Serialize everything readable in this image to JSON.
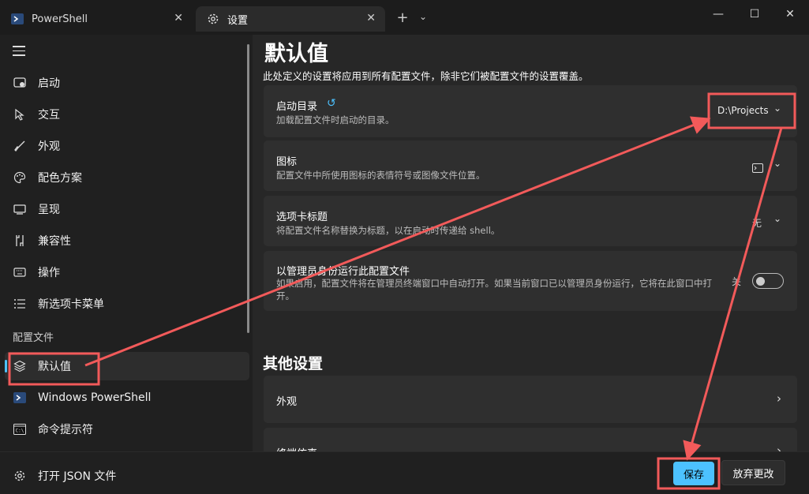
{
  "tabs": [
    {
      "label": "PowerShell",
      "icon": "powershell-icon"
    },
    {
      "label": "设置",
      "icon": "gear-icon"
    }
  ],
  "window_controls": {
    "minimize": "—",
    "maximize": "☐",
    "close": "✕"
  },
  "sidebar": {
    "items": [
      {
        "label": "启动",
        "icon": "startup-icon"
      },
      {
        "label": "交互",
        "icon": "cursor-icon"
      },
      {
        "label": "外观",
        "icon": "brush-icon"
      },
      {
        "label": "配色方案",
        "icon": "palette-icon"
      },
      {
        "label": "呈现",
        "icon": "monitor-icon"
      },
      {
        "label": "兼容性",
        "icon": "compat-icon"
      },
      {
        "label": "操作",
        "icon": "keyboard-icon"
      },
      {
        "label": "新选项卡菜单",
        "icon": "list-icon"
      }
    ],
    "section_label": "配置文件",
    "profiles": [
      {
        "label": "默认值",
        "icon": "layers-icon",
        "active": true
      },
      {
        "label": "Windows PowerShell",
        "icon": "powershell-icon"
      },
      {
        "label": "命令提示符",
        "icon": "cmd-icon"
      }
    ],
    "open_json": {
      "label": "打开 JSON 文件",
      "icon": "gear-icon"
    }
  },
  "main": {
    "title": "默认值",
    "description": "此处定义的设置将应用到所有配置文件，除非它们被配置文件的设置覆盖。",
    "cards": [
      {
        "title": "启动目录",
        "desc": "加载配置文件时启动的目录。",
        "value": "D:\\Projects"
      },
      {
        "title": "图标",
        "desc": "配置文件中所使用图标的表情符号或图像文件位置。"
      },
      {
        "title": "选项卡标题",
        "desc": "将配置文件名称替换为标题，以在启动时传递给 shell。",
        "value": "无"
      },
      {
        "title": "以管理员身份运行此配置文件",
        "desc": "如果启用，配置文件将在管理员终端窗口中自动打开。如果当前窗口已以管理员身份运行，它将在此窗口中打开。",
        "toggle_label": "关",
        "toggle_on": false
      }
    ],
    "other_title": "其他设置",
    "other_items": [
      {
        "label": "外观"
      },
      {
        "label": "终端仿真"
      }
    ]
  },
  "buttons": {
    "save": "保存",
    "discard": "放弃更改"
  },
  "colors": {
    "accent": "#4cc2ff",
    "annotation": "#f25a5a"
  }
}
